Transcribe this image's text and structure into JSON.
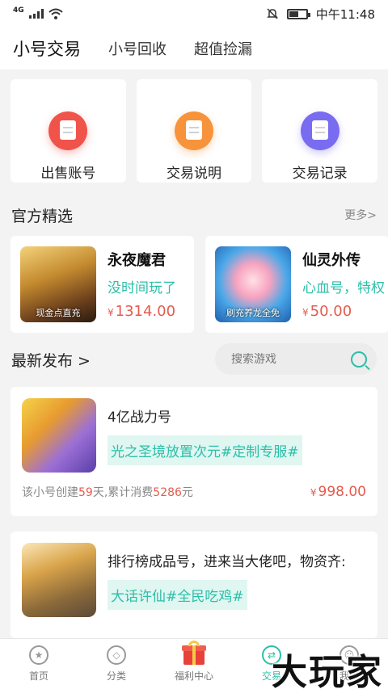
{
  "status_bar": {
    "network": "4G",
    "time": "中午11:48",
    "battery_level": 0.55
  },
  "top_tabs": [
    {
      "label": "小号交易",
      "active": true
    },
    {
      "label": "小号回收",
      "active": false
    },
    {
      "label": "超值捡漏",
      "active": false
    }
  ],
  "quick_actions": [
    {
      "label": "出售账号",
      "icon": "sell-account-icon",
      "color": "#f0534a"
    },
    {
      "label": "交易说明",
      "icon": "trade-guide-icon",
      "color": "#f7933b"
    },
    {
      "label": "交易记录",
      "icon": "trade-record-icon",
      "color": "#7a6cf0"
    }
  ],
  "featured_section": {
    "title": "官方精选",
    "more_label": "更多>",
    "items": [
      {
        "name": "永夜魔君",
        "desc": "没时间玩了",
        "currency": "¥",
        "price": "1314.00",
        "thumb_caption": "现金点直充"
      },
      {
        "name": "仙灵外传",
        "desc": "心血号，特权",
        "currency": "¥",
        "price": "50.00",
        "thumb_caption": "刷充养龙全免"
      }
    ]
  },
  "latest_section": {
    "title": "最新发布 >",
    "search": {
      "placeholder": "搜索游戏"
    }
  },
  "listings": [
    {
      "title": "4亿战力号",
      "tags": "光之圣境放置次元#定制专服#",
      "meta_prefix": "该小号创建",
      "days": "59",
      "meta_mid": "天,累计消费",
      "spent": "5286",
      "meta_suffix": "元",
      "currency": "¥",
      "price": "998.00"
    },
    {
      "title": "排行榜成品号，进来当大佬吧，物资齐:",
      "tags": "大话许仙#全民吃鸡#"
    }
  ],
  "bottom_nav": [
    {
      "label": "首页",
      "icon": "home-icon",
      "active": false
    },
    {
      "label": "分类",
      "icon": "compass-icon",
      "active": false
    },
    {
      "label": "福利中心",
      "icon": "gift-icon",
      "active": false
    },
    {
      "label": "交易",
      "icon": "trade-icon",
      "active": true
    },
    {
      "label": "我的",
      "icon": "profile-icon",
      "active": false
    }
  ],
  "watermark": "大玩家"
}
